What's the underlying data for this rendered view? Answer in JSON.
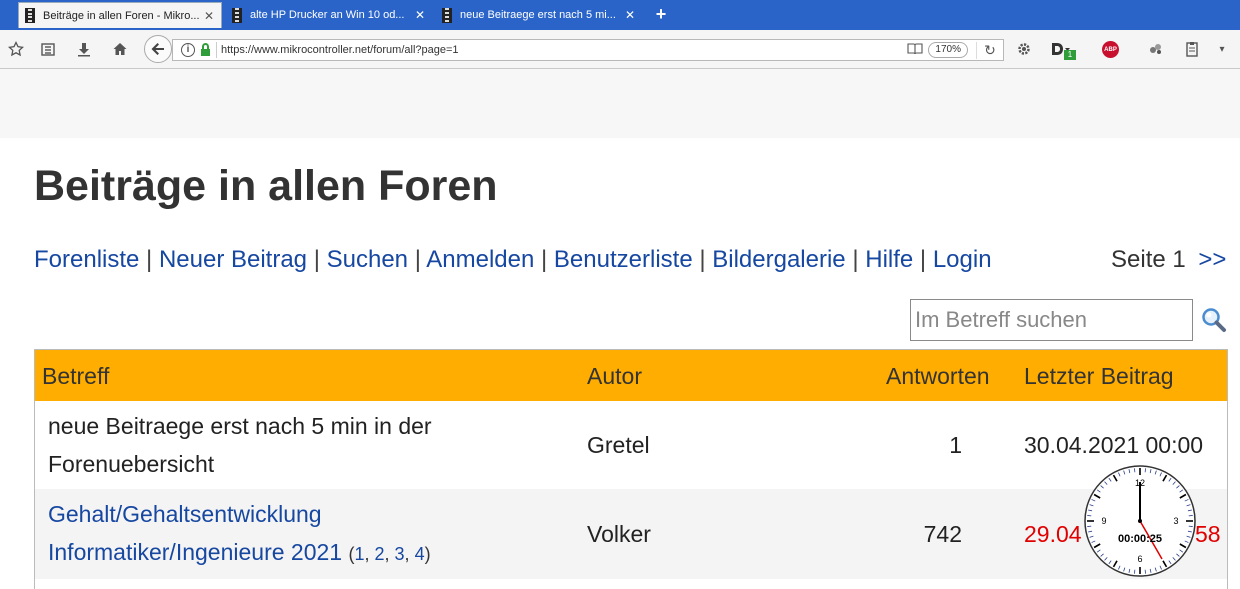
{
  "browser": {
    "tabs": [
      {
        "title": "Beiträge in allen Foren - Mikro...",
        "active": true
      },
      {
        "title": "alte HP Drucker an Win 10 od...",
        "active": false
      },
      {
        "title": "neue Beitraege erst nach 5 mi...",
        "active": false
      }
    ],
    "new_tab_symbol": "+",
    "close_symbol": "✕",
    "url": "https://www.mikrocontroller.net/forum/all?page=1",
    "zoom": "170%",
    "download_badge": "1",
    "adblock_label": "ABP",
    "colors": {
      "tabstrip": "#2a64c8",
      "security_lock": "#2f9e3a",
      "adblock": "#c8102e"
    }
  },
  "page": {
    "heading": "Beiträge in allen Foren",
    "nav_links": [
      "Forenliste",
      "Neuer Beitrag",
      "Suchen",
      "Anmelden",
      "Benutzerliste",
      "Bildergalerie",
      "Hilfe",
      "Login"
    ],
    "nav_separator": "|",
    "pagination": {
      "label": "Seite 1",
      "next": ">>"
    },
    "search": {
      "placeholder": "Im Betreff suchen",
      "value": ""
    },
    "table": {
      "headers": {
        "subject": "Betreff",
        "author": "Autor",
        "answers": "Antworten",
        "last_post": "Letzter Beitrag"
      },
      "header_color": "#ffad00",
      "rows": [
        {
          "subject_line1": "neue Beitraege erst nach 5 min in der",
          "subject_line2": "Forenuebersicht",
          "author": "Gretel",
          "answers": "1",
          "last_post": "30.04.2021 00:00"
        },
        {
          "subject_line1": "Gehalt/Gehaltsentwicklung",
          "subject_line2": "Informatiker/Ingenieure 2021",
          "pages": [
            "1",
            "2",
            "3",
            "4"
          ],
          "author": "Volker",
          "answers": "742",
          "last_post_visible_start": "29.04",
          "last_post_visible_end": "58",
          "last_post_color": "#e00000"
        }
      ]
    }
  },
  "clock_overlay": {
    "time": "00:00:25",
    "labels": [
      "12",
      "3",
      "6",
      "9"
    ]
  }
}
